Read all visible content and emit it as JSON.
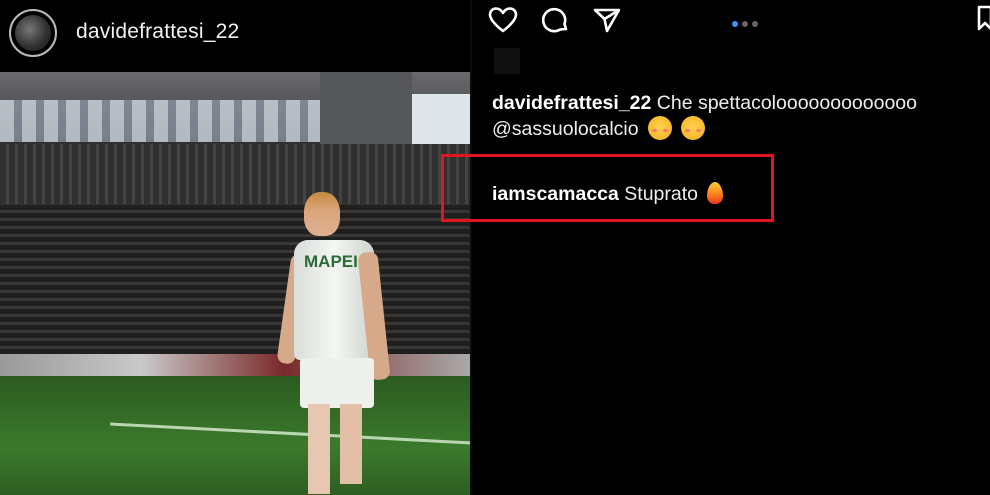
{
  "post": {
    "username": "davidefrattesi_22",
    "shirt_text": "MAPEI"
  },
  "actions": {
    "like_icon": "heart-icon",
    "comment_icon": "comment-icon",
    "share_icon": "share-icon",
    "save_icon": "bookmark-icon",
    "carousel_dots": 3,
    "carousel_active": 1
  },
  "caption": {
    "username": "davidefrattesi_22",
    "text": "Che spettacolooooooooooooo",
    "mention": "@sassuolocalcio",
    "emojis": [
      "smiling-face-with-hearts",
      "smiling-face-with-hearts"
    ]
  },
  "highlighted_comment": {
    "username": "iamscamacca",
    "text": "Stuprato",
    "emoji": "fire",
    "highlight_color": "#e3141e"
  },
  "colors": {
    "background": "#000000",
    "text": "#eeeeee",
    "accent_dot": "#3897f0"
  }
}
